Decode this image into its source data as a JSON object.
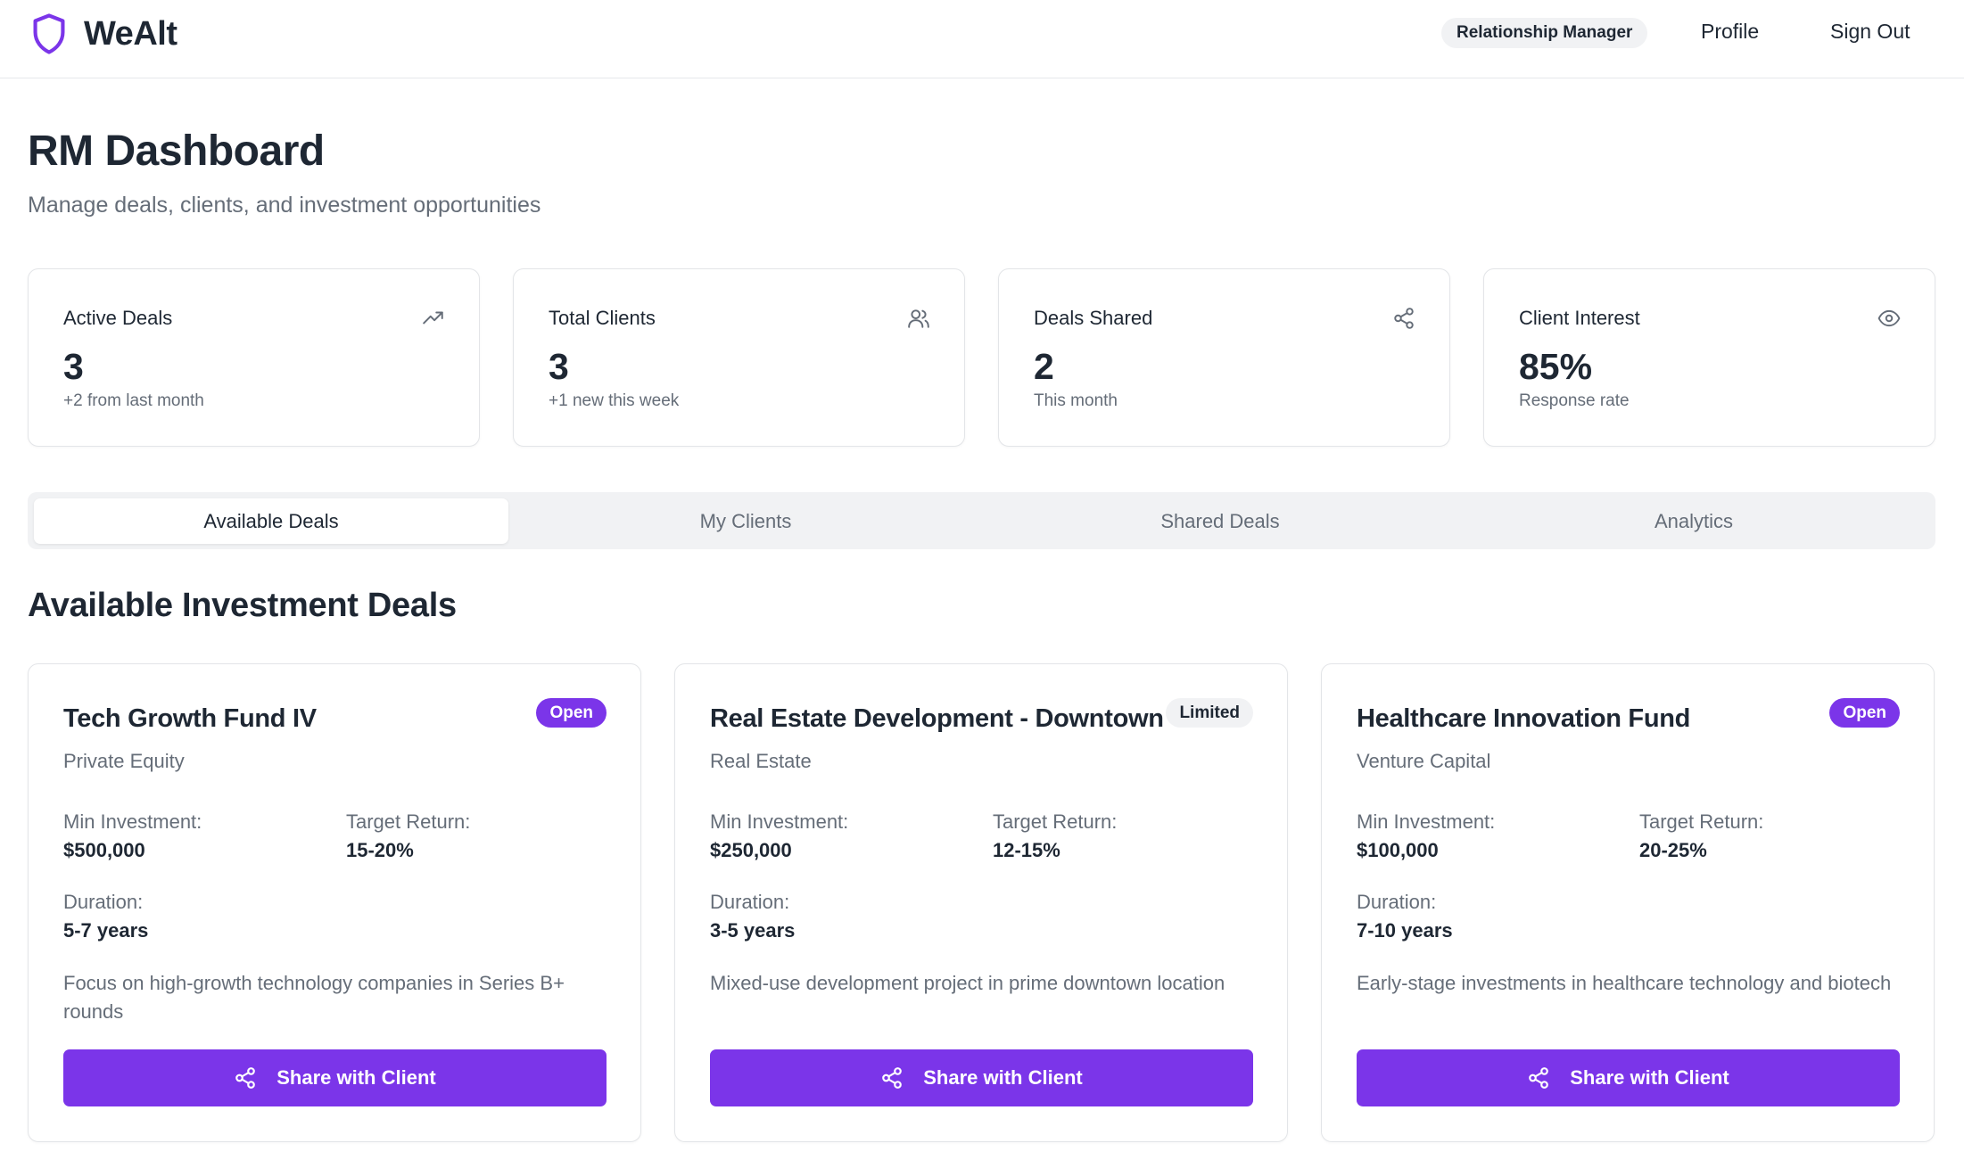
{
  "app": {
    "name": "WeAlt"
  },
  "header": {
    "role_badge": "Relationship Manager",
    "profile_label": "Profile",
    "signout_label": "Sign Out"
  },
  "page": {
    "title": "RM Dashboard",
    "subtitle": "Manage deals, clients, and investment opportunities"
  },
  "stats": [
    {
      "label": "Active Deals",
      "value": "3",
      "sub": "+2 from last month",
      "icon": "trending-up-icon"
    },
    {
      "label": "Total Clients",
      "value": "3",
      "sub": "+1 new this week",
      "icon": "users-icon"
    },
    {
      "label": "Deals Shared",
      "value": "2",
      "sub": "This month",
      "icon": "share-icon"
    },
    {
      "label": "Client Interest",
      "value": "85%",
      "sub": "Response rate",
      "icon": "eye-icon"
    }
  ],
  "tabs": [
    {
      "label": "Available Deals",
      "active": true
    },
    {
      "label": "My Clients",
      "active": false
    },
    {
      "label": "Shared Deals",
      "active": false
    },
    {
      "label": "Analytics",
      "active": false
    }
  ],
  "section_title": "Available Investment Deals",
  "field_labels": {
    "min_investment": "Min Investment:",
    "target_return": "Target Return:",
    "duration": "Duration:"
  },
  "deals": [
    {
      "name": "Tech Growth Fund IV",
      "badge": "Open",
      "type": "Private Equity",
      "min_investment": "$500,000",
      "target_return": "15-20%",
      "duration": "5-7 years",
      "description": "Focus on high-growth technology companies in Series B+ rounds",
      "button": "Share with Client"
    },
    {
      "name": "Real Estate Development - Downtown",
      "badge": "Limited",
      "type": "Real Estate",
      "min_investment": "$250,000",
      "target_return": "12-15%",
      "duration": "3-5 years",
      "description": "Mixed-use development project in prime downtown location",
      "button": "Share with Client"
    },
    {
      "name": "Healthcare Innovation Fund",
      "badge": "Open",
      "type": "Venture Capital",
      "min_investment": "$100,000",
      "target_return": "20-25%",
      "duration": "7-10 years",
      "description": "Early-stage investments in healthcare technology and biotech",
      "button": "Share with Client"
    }
  ],
  "colors": {
    "accent": "#7b35e9",
    "text": "#1e2733",
    "muted": "#656d78",
    "border": "#e3e5e8"
  }
}
